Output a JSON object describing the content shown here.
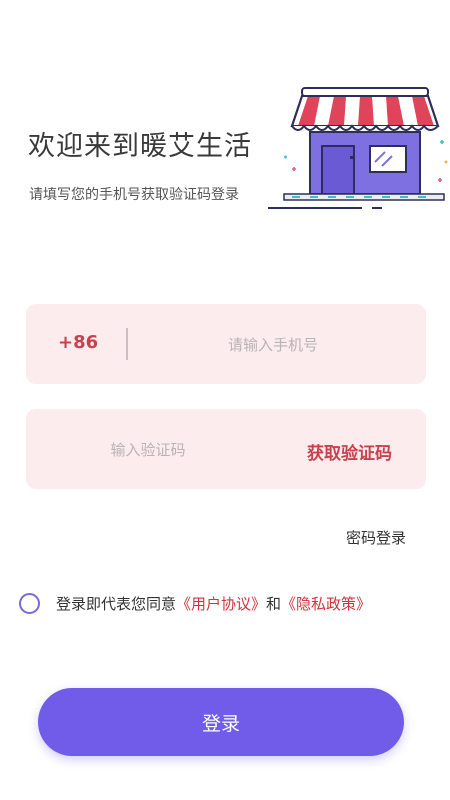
{
  "header": {
    "title": "欢迎来到暖艾生活",
    "subtitle": "请填写您的手机号获取验证码登录"
  },
  "phone_field": {
    "country_code": "+86",
    "placeholder": "请输入手机号",
    "value": ""
  },
  "code_field": {
    "placeholder": "输入验证码",
    "value": "",
    "get_code_label": "获取验证码"
  },
  "password_login_label": "密码登录",
  "agreement": {
    "checked": false,
    "prefix": "登录即代表您同意",
    "user_agreement": "《用户协议》",
    "connector": "和",
    "privacy_policy": "《隐私政策》"
  },
  "login_button_label": "登录",
  "colors": {
    "accent": "#705ce8",
    "link_red": "#d2333d",
    "field_bg": "#fcecee"
  },
  "illustration": "storefront-illustration"
}
